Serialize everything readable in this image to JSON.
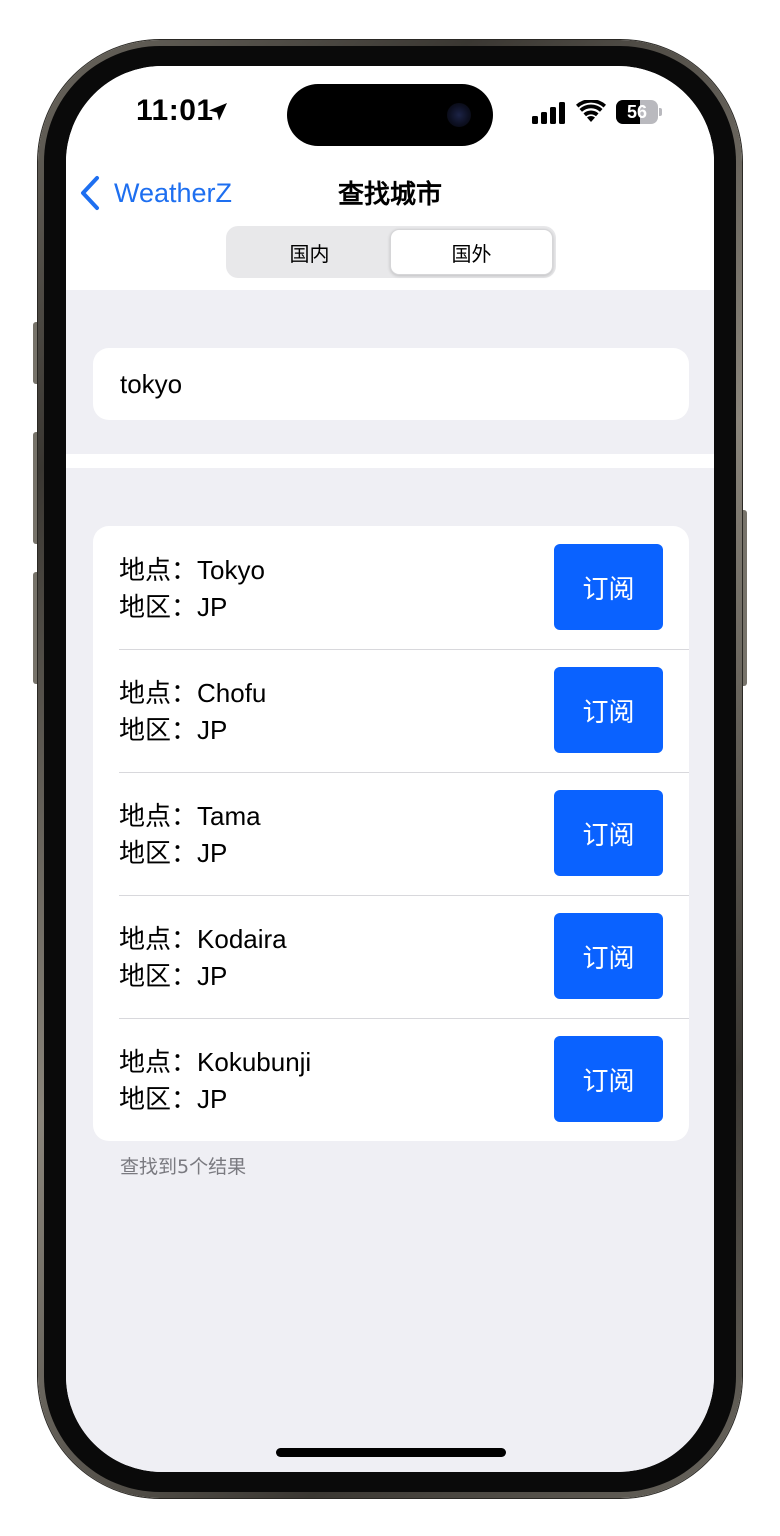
{
  "status_bar": {
    "time": "11:01",
    "battery_level": "56",
    "battery_fraction": 0.56,
    "icons": [
      "location-arrow-icon",
      "cellular-signal-icon",
      "wifi-icon",
      "battery-icon"
    ]
  },
  "nav": {
    "back_label": "WeatherZ",
    "title": "查找城市",
    "segments": [
      {
        "label": "国内",
        "selected": false
      },
      {
        "label": "国外",
        "selected": true
      }
    ]
  },
  "search": {
    "value": "tokyo",
    "placeholder": ""
  },
  "results": {
    "location_key": "地点：",
    "region_key": "地区：",
    "subscribe_label": "订阅",
    "items": [
      {
        "location": "Tokyo",
        "region": "JP"
      },
      {
        "location": "Chofu",
        "region": "JP"
      },
      {
        "location": "Tama",
        "region": "JP"
      },
      {
        "location": "Kodaira",
        "region": "JP"
      },
      {
        "location": "Kokubunji",
        "region": "JP"
      }
    ],
    "summary": "查找到5个结果"
  },
  "colors": {
    "accent": "#1e6ff0",
    "button": "#0a62ff",
    "background": "#efeff4"
  }
}
